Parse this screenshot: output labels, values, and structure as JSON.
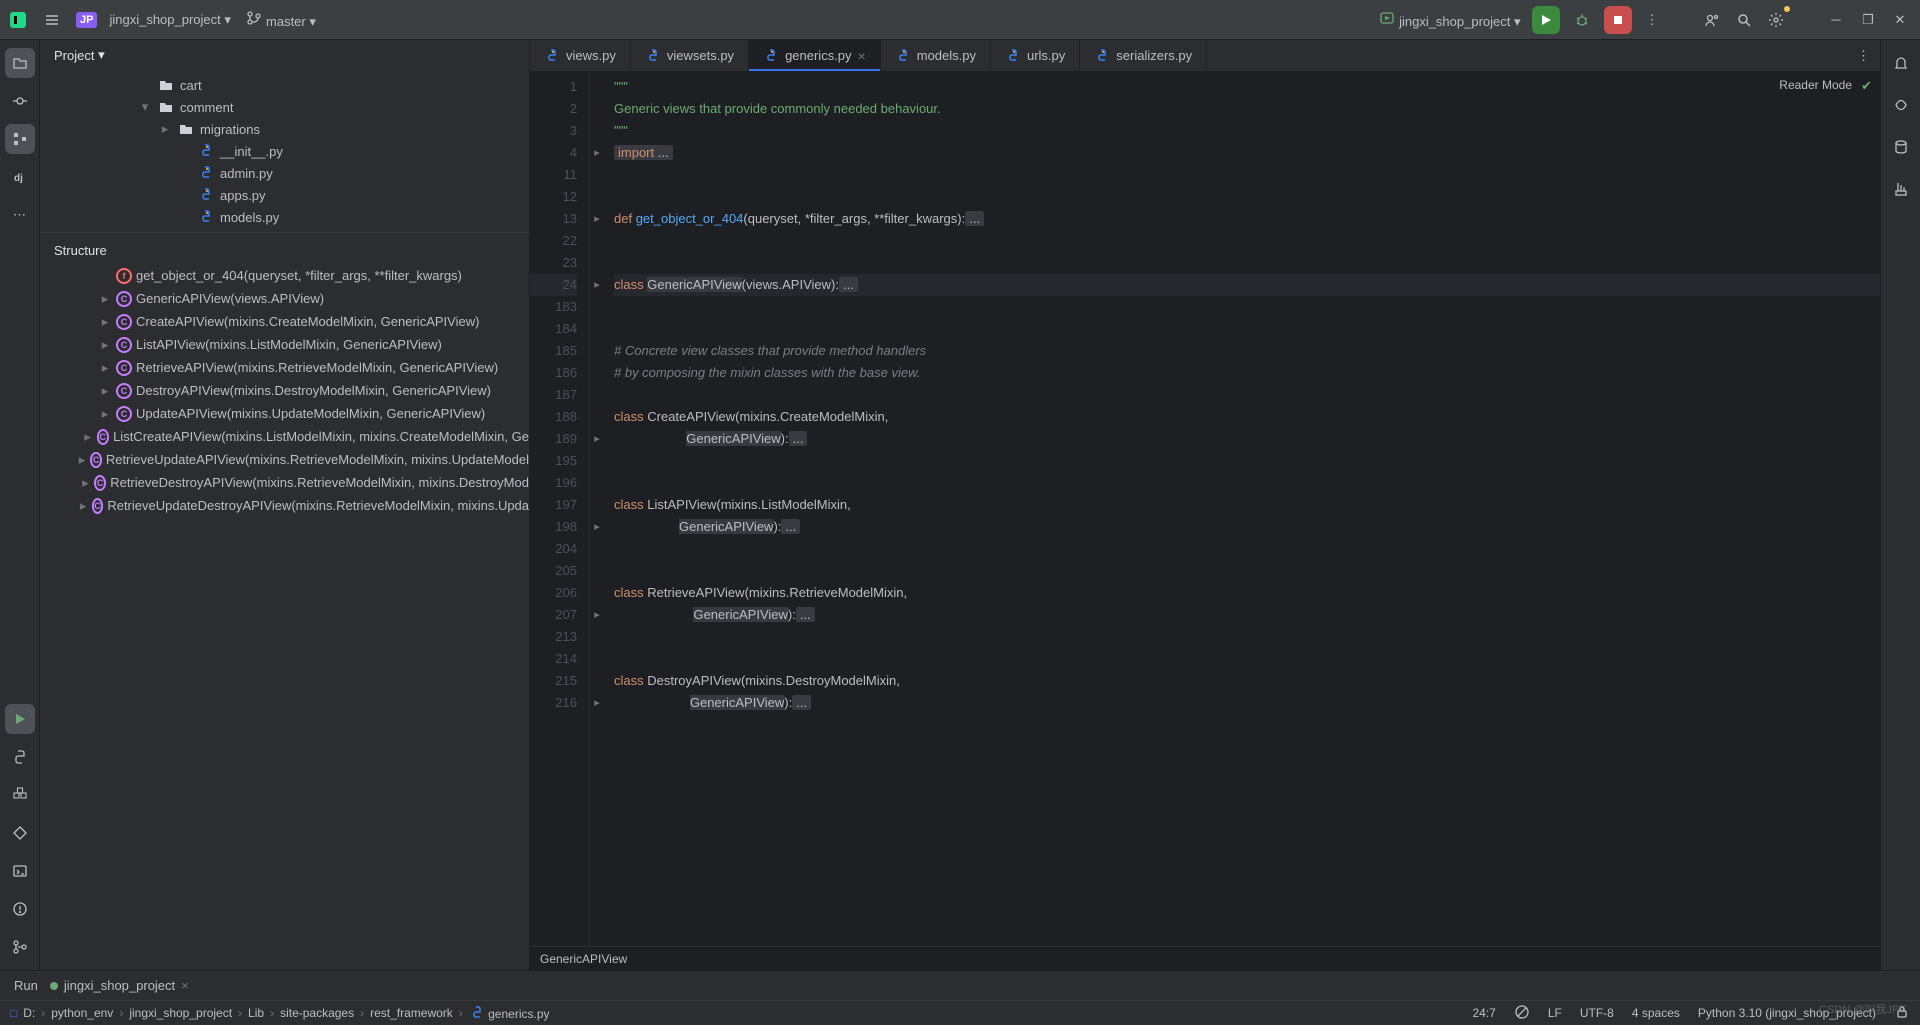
{
  "titlebar": {
    "project_badge": "JP",
    "project_name": "jingxi_shop_project",
    "branch": "master",
    "run_config": "jingxi_shop_project"
  },
  "panels": {
    "project_label": "Project",
    "structure_label": "Structure"
  },
  "tree": [
    {
      "indent": 80,
      "kind": "folder",
      "label": "cart",
      "arrow": ""
    },
    {
      "indent": 80,
      "kind": "folder",
      "label": "comment",
      "arrow": "▾"
    },
    {
      "indent": 100,
      "kind": "folder",
      "label": "migrations",
      "arrow": "▸"
    },
    {
      "indent": 120,
      "kind": "py",
      "label": "__init__.py",
      "arrow": ""
    },
    {
      "indent": 120,
      "kind": "py",
      "label": "admin.py",
      "arrow": ""
    },
    {
      "indent": 120,
      "kind": "py",
      "label": "apps.py",
      "arrow": ""
    },
    {
      "indent": 120,
      "kind": "py",
      "label": "models.py",
      "arrow": ""
    }
  ],
  "structure": [
    {
      "arrow": "",
      "kind": "f",
      "label": "get_object_or_404(queryset, *filter_args, **filter_kwargs)",
      "indent": 54
    },
    {
      "arrow": "▸",
      "kind": "c",
      "label": "GenericAPIView(views.APIView)",
      "indent": 54
    },
    {
      "arrow": "▸",
      "kind": "c",
      "label": "CreateAPIView(mixins.CreateModelMixin, GenericAPIView)",
      "indent": 54
    },
    {
      "arrow": "▸",
      "kind": "c",
      "label": "ListAPIView(mixins.ListModelMixin, GenericAPIView)",
      "indent": 54
    },
    {
      "arrow": "▸",
      "kind": "c",
      "label": "RetrieveAPIView(mixins.RetrieveModelMixin, GenericAPIView)",
      "indent": 54
    },
    {
      "arrow": "▸",
      "kind": "c",
      "label": "DestroyAPIView(mixins.DestroyModelMixin, GenericAPIView)",
      "indent": 54
    },
    {
      "arrow": "▸",
      "kind": "c",
      "label": "UpdateAPIView(mixins.UpdateModelMixin, GenericAPIView)",
      "indent": 54
    },
    {
      "arrow": "▸",
      "kind": "c",
      "label": "ListCreateAPIView(mixins.ListModelMixin, mixins.CreateModelMixin, Ge",
      "indent": 54
    },
    {
      "arrow": "▸",
      "kind": "c",
      "label": "RetrieveUpdateAPIView(mixins.RetrieveModelMixin, mixins.UpdateModel",
      "indent": 54
    },
    {
      "arrow": "▸",
      "kind": "c",
      "label": "RetrieveDestroyAPIView(mixins.RetrieveModelMixin, mixins.DestroyMod",
      "indent": 54
    },
    {
      "arrow": "▸",
      "kind": "c",
      "label": "RetrieveUpdateDestroyAPIView(mixins.RetrieveModelMixin, mixins.Upda",
      "indent": 54
    }
  ],
  "tabs": [
    {
      "label": "views.py",
      "active": false
    },
    {
      "label": "viewsets.py",
      "active": false
    },
    {
      "label": "generics.py",
      "active": true,
      "closeable": true
    },
    {
      "label": "models.py",
      "active": false
    },
    {
      "label": "urls.py",
      "active": false
    },
    {
      "label": "serializers.py",
      "active": false
    }
  ],
  "reader_mode": "Reader Mode",
  "code": {
    "lines": [
      {
        "n": 1,
        "fold": "",
        "html": "<span class='str'>\"\"\"</span>"
      },
      {
        "n": 2,
        "fold": "",
        "html": "<span class='str'>Generic views that provide commonly needed behaviour.</span>"
      },
      {
        "n": 3,
        "fold": "",
        "html": "<span class='str'>\"\"\"</span>"
      },
      {
        "n": 4,
        "fold": "▸",
        "html": "<span class='folded'><span class='kw'>import</span> ...</span>"
      },
      {
        "n": 11,
        "fold": "",
        "html": ""
      },
      {
        "n": 12,
        "fold": "",
        "html": ""
      },
      {
        "n": 13,
        "fold": "▸",
        "html": "<span class='kw'>def</span> <span class='fn'>get_object_or_404</span>(queryset, *filter_args, **filter_kwargs):<span class='folded'>...</span>"
      },
      {
        "n": 22,
        "fold": "",
        "html": ""
      },
      {
        "n": 23,
        "fold": "",
        "html": ""
      },
      {
        "n": 24,
        "fold": "▸",
        "html": "<span class='kw'>class</span> <span class='hl'>GenericAPIView</span>(views.APIView):<span class='folded'>...</span>",
        "cur": true,
        "caret": true
      },
      {
        "n": 183,
        "fold": "",
        "html": ""
      },
      {
        "n": 184,
        "fold": "",
        "html": ""
      },
      {
        "n": 185,
        "fold": "",
        "html": "<span class='com'># Concrete view classes that provide method handlers</span>"
      },
      {
        "n": 186,
        "fold": "",
        "html": "<span class='com'># by composing the mixin classes with the base view.</span>"
      },
      {
        "n": 187,
        "fold": "",
        "html": ""
      },
      {
        "n": 188,
        "fold": "",
        "html": "<span class='kw'>class</span> <span class='cls-n'>CreateAPIView</span>(mixins.CreateModelMixin,"
      },
      {
        "n": 189,
        "fold": "▸",
        "html": "                    <span class='hl'>GenericAPIView</span>):<span class='folded'>...</span>"
      },
      {
        "n": 195,
        "fold": "",
        "html": ""
      },
      {
        "n": 196,
        "fold": "",
        "html": ""
      },
      {
        "n": 197,
        "fold": "",
        "html": "<span class='kw'>class</span> <span class='cls-n'>ListAPIView</span>(mixins.ListModelMixin,"
      },
      {
        "n": 198,
        "fold": "▸",
        "html": "                  <span class='hl'>GenericAPIView</span>):<span class='folded'>...</span>"
      },
      {
        "n": 204,
        "fold": "",
        "html": ""
      },
      {
        "n": 205,
        "fold": "",
        "html": ""
      },
      {
        "n": 206,
        "fold": "",
        "html": "<span class='kw'>class</span> <span class='cls-n'>RetrieveAPIView</span>(mixins.RetrieveModelMixin,"
      },
      {
        "n": 207,
        "fold": "▸",
        "html": "                      <span class='hl'>GenericAPIView</span>):<span class='folded'>...</span>"
      },
      {
        "n": 213,
        "fold": "",
        "html": ""
      },
      {
        "n": 214,
        "fold": "",
        "html": ""
      },
      {
        "n": 215,
        "fold": "",
        "html": "<span class='kw'>class</span> <span class='cls-n'>DestroyAPIView</span>(mixins.DestroyModelMixin,"
      },
      {
        "n": 216,
        "fold": "▸",
        "html": "                     <span class='hl'>GenericAPIView</span>):<span class='folded'>...</span>"
      }
    ]
  },
  "editor_bc": "GenericAPIView",
  "run": {
    "label": "Run",
    "config": "jingxi_shop_project"
  },
  "breadcrumbs": [
    "D:",
    "python_env",
    "jingxi_shop_project",
    "Lib",
    "site-packages",
    "rest_framework",
    "generics.py"
  ],
  "status": {
    "pos": "24:7",
    "le": "LF",
    "enc": "UTF-8",
    "indent": "4 spaces",
    "interpreter": "Python 3.10 (jingxi_shop_project)"
  },
  "watermark": "CSDN @叫我JPT"
}
